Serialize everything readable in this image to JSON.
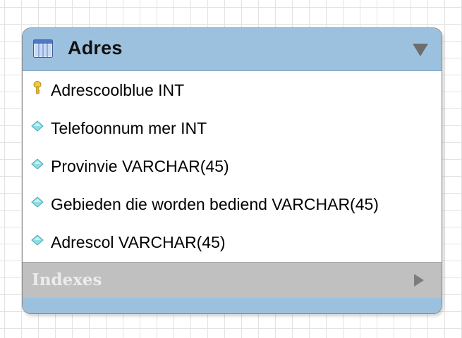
{
  "table": {
    "title": "Adres",
    "header_color": "#9cc1de",
    "icon": "table-icon",
    "collapse_icon": "triangle-down-icon",
    "columns": [
      {
        "label": "Adrescoolblue INT",
        "icon": "primary-key-icon"
      },
      {
        "label": "Telefoonnum mer INT",
        "icon": "column-diamond-icon"
      },
      {
        "label": "Provinvie VARCHAR(45)",
        "icon": "column-diamond-icon"
      },
      {
        "label": "Gebieden die worden bediend VARCHAR(45)",
        "icon": "column-diamond-icon"
      },
      {
        "label": "Adrescol VARCHAR(45)",
        "icon": "column-diamond-icon"
      }
    ],
    "indexes": {
      "label": "Indexes",
      "expand_icon": "triangle-right-icon"
    }
  }
}
